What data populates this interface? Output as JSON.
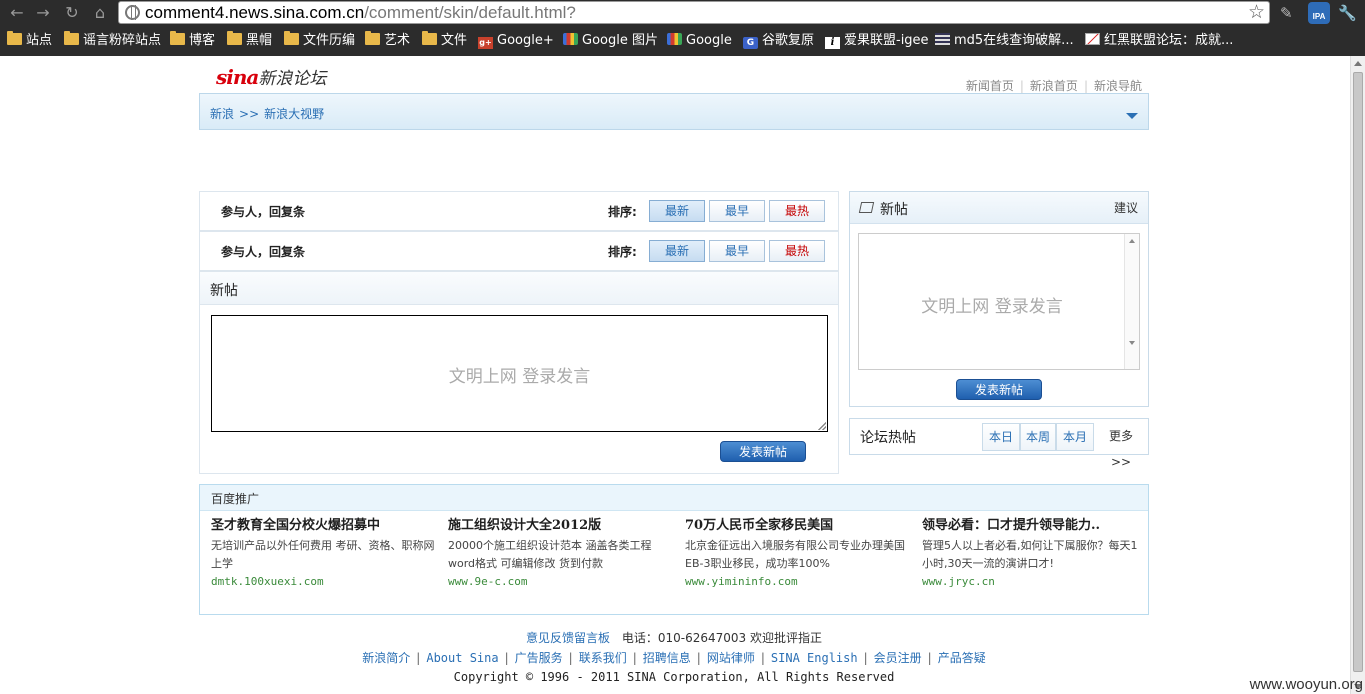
{
  "browser": {
    "url_host": "comment4.news.sina.com.cn",
    "url_path": "/comment/skin/default.html?",
    "bookmarks": [
      {
        "label": "站点",
        "icon": "folder-icon"
      },
      {
        "label": "谣言粉碎站点",
        "icon": "folder-icon"
      },
      {
        "label": "博客",
        "icon": "folder-icon"
      },
      {
        "label": "黑帽",
        "icon": "folder-icon"
      },
      {
        "label": "文件历编",
        "icon": "folder-icon"
      },
      {
        "label": "艺术",
        "icon": "folder-icon"
      },
      {
        "label": "文件",
        "icon": "folder-icon"
      },
      {
        "label": "Google+",
        "icon": "google-plus-icon"
      },
      {
        "label": "Google 图片",
        "icon": "google-icon"
      },
      {
        "label": "Google",
        "icon": "google-icon"
      },
      {
        "label": "谷歌复原",
        "icon": "google-restore-icon"
      },
      {
        "label": "爱果联盟-igee",
        "icon": "igee-icon"
      },
      {
        "label": "md5在线查询破解...",
        "icon": "md5-icon"
      },
      {
        "label": "红黑联盟论坛：成就...",
        "icon": "redblack-icon"
      }
    ],
    "ipa_label": "IPA"
  },
  "header": {
    "logo_sina": "sina",
    "logo_forum": "新浪论坛",
    "top_links": [
      "新闻首页",
      "新浪首页",
      "新浪导航"
    ],
    "breadcrumb": [
      "新浪",
      "新浪大视野"
    ],
    "breadcrumb_sep": ">>"
  },
  "sort_rows": [
    {
      "label": "参与人，回复条",
      "sort_label": "排序:",
      "buttons": [
        "最新",
        "最早",
        "最热"
      ]
    },
    {
      "label": "参与人，回复条",
      "sort_label": "排序:",
      "buttons": [
        "最新",
        "最早",
        "最热"
      ]
    }
  ],
  "new_post": {
    "title": "新帖",
    "placeholder": "文明上网   登录发言",
    "submit": "发表新帖"
  },
  "side_post": {
    "title": "新帖",
    "suggest": "建议",
    "placeholder": "文明上网   登录发言",
    "submit": "发表新帖"
  },
  "hot": {
    "title": "论坛热帖",
    "tabs": [
      "本日",
      "本周",
      "本月"
    ],
    "more": "更多>>"
  },
  "ads": {
    "title": "百度推广",
    "items": [
      {
        "title": "圣才教育全国分校火爆招募中",
        "desc": "无培训产品以外任何费用 考研、资格、职称网上学",
        "url": "dmtk.100xuexi.com"
      },
      {
        "title": "施工组织设计大全2012版",
        "desc": "20000个施工组织设计范本 涵盖各类工程word格式 可编辑修改 货到付款",
        "url": "www.9e-c.com"
      },
      {
        "title": "70万人民币全家移民美国",
        "desc": "北京金征远出入境服务有限公司专业办理美国EB-3职业移民，成功率100%",
        "url": "www.yimininfo.com"
      },
      {
        "title": "领导必看：口才提升领导能力..",
        "desc": "管理5人以上者必看,如何让下属服你？每天1小时,30天一流的演讲口才!",
        "url": "www.jryc.cn"
      }
    ]
  },
  "footer": {
    "feedback": "意见反馈留言板",
    "phone": "电话：010-62647003 欢迎批评指正",
    "links": [
      "新浪简介",
      "About Sina",
      "广告服务",
      "联系我们",
      "招聘信息",
      "网站律师",
      "SINA English",
      "会员注册",
      "产品答疑"
    ],
    "copyright": "Copyright © 1996 - 2011 SINA Corporation, All Rights Reserved"
  },
  "watermark": "www.wooyun.org"
}
